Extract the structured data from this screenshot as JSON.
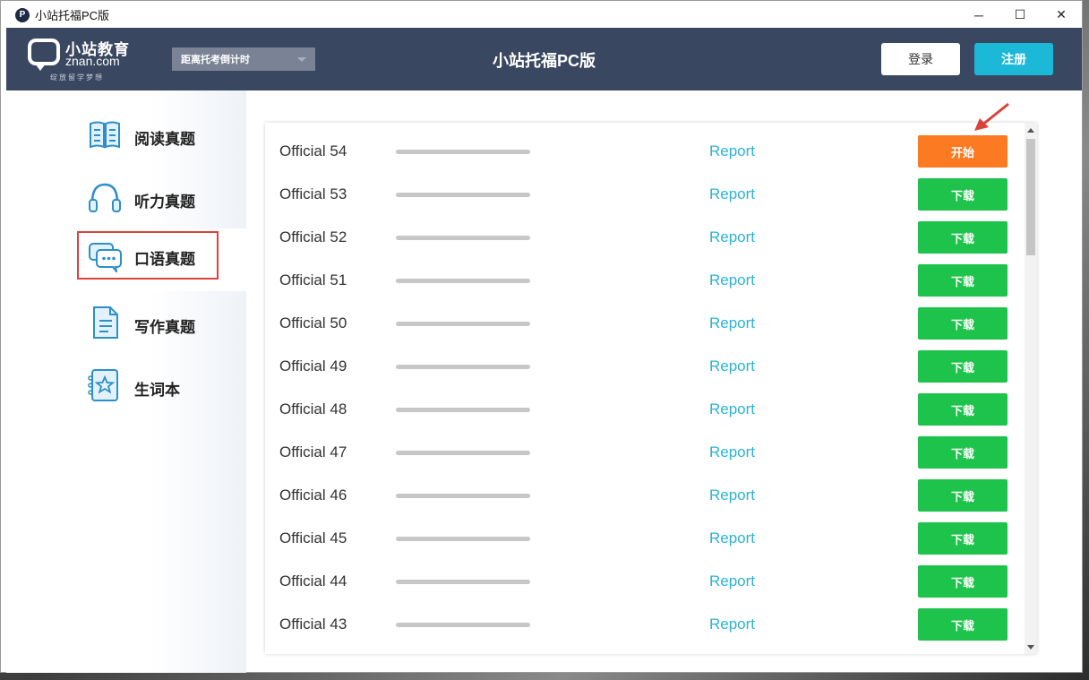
{
  "window": {
    "app_icon": "P",
    "title": "小站托福PC版",
    "controls": [
      "─",
      "☐",
      "✕"
    ]
  },
  "header": {
    "logo_cn": "小站教育",
    "logo_en": "znan.com",
    "logo_tagline": "绽放留学梦想",
    "countdown_label": "距离托考倒计时",
    "title": "小站托福PC版",
    "login_label": "登录",
    "register_label": "注册",
    "colors": {
      "header_bg": "#3a4760",
      "register_bg": "#1bb8d8"
    }
  },
  "sidebar": {
    "items": [
      {
        "label": "阅读真题",
        "icon": "book-icon"
      },
      {
        "label": "听力真题",
        "icon": "headphones-icon"
      },
      {
        "label": "口语真题",
        "icon": "chat-bubbles-icon",
        "active": true
      },
      {
        "label": "写作真题",
        "icon": "document-icon"
      },
      {
        "label": "生词本",
        "icon": "star-notebook-icon"
      }
    ]
  },
  "tests": [
    {
      "name": "Official 54",
      "report": "Report",
      "action": "开始",
      "type": "start",
      "progress": 0
    },
    {
      "name": "Official 53",
      "report": "Report",
      "action": "下载",
      "type": "download",
      "progress": 0
    },
    {
      "name": "Official 52",
      "report": "Report",
      "action": "下载",
      "type": "download",
      "progress": 0
    },
    {
      "name": "Official 51",
      "report": "Report",
      "action": "下载",
      "type": "download",
      "progress": 0
    },
    {
      "name": "Official 50",
      "report": "Report",
      "action": "下载",
      "type": "download",
      "progress": 0
    },
    {
      "name": "Official 49",
      "report": "Report",
      "action": "下载",
      "type": "download",
      "progress": 0
    },
    {
      "name": "Official 48",
      "report": "Report",
      "action": "下载",
      "type": "download",
      "progress": 0
    },
    {
      "name": "Official 47",
      "report": "Report",
      "action": "下载",
      "type": "download",
      "progress": 0
    },
    {
      "name": "Official 46",
      "report": "Report",
      "action": "下载",
      "type": "download",
      "progress": 0
    },
    {
      "name": "Official 45",
      "report": "Report",
      "action": "下载",
      "type": "download",
      "progress": 0
    },
    {
      "name": "Official 44",
      "report": "Report",
      "action": "下载",
      "type": "download",
      "progress": 0
    },
    {
      "name": "Official 43",
      "report": "Report",
      "action": "下载",
      "type": "download",
      "progress": 0
    }
  ],
  "colors": {
    "start_button": "#fb7a22",
    "download_button": "#1dc34a",
    "report_link": "#2bb3d6",
    "annotation": "#d9433c"
  }
}
